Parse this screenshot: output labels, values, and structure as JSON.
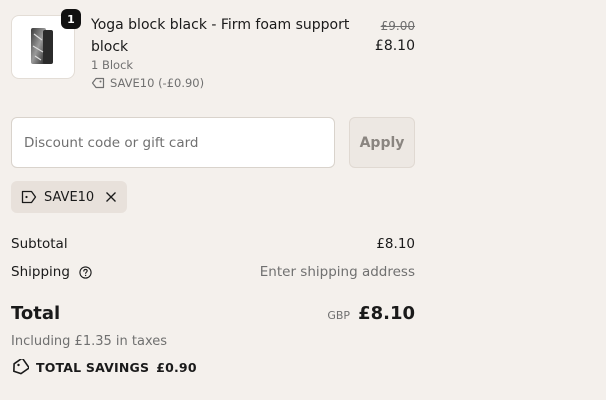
{
  "line_item": {
    "quantity": "1",
    "title": "Yoga block black - Firm foam support block",
    "variant": "1 Block",
    "discount_label": "SAVE10 (-£0.90)",
    "original_price": "£9.00",
    "price": "£8.10",
    "image_icon": "product-image"
  },
  "discount_form": {
    "placeholder": "Discount code or gift card",
    "apply_label": "Apply"
  },
  "applied_code": {
    "code": "SAVE10",
    "tag_icon": "tag-icon",
    "remove_icon": "close-icon"
  },
  "summary": {
    "subtotal_label": "Subtotal",
    "subtotal_value": "£8.10",
    "shipping_label": "Shipping",
    "shipping_value": "Enter shipping address",
    "total_label": "Total",
    "currency": "GBP",
    "total_value": "£8.10",
    "tax_note": "Including £1.35 in taxes",
    "savings_label": "TOTAL SAVINGS",
    "savings_value": "£0.90"
  },
  "colors": {
    "background": "#f4f0ec",
    "text": "#1a1a1a",
    "muted": "#707070",
    "chip": "#e8e1db"
  }
}
